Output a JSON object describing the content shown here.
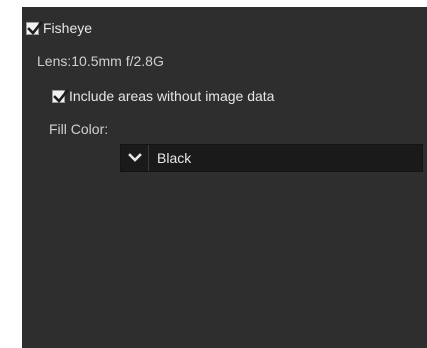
{
  "fisheye": {
    "label": "Fisheye",
    "checked": true
  },
  "lens": {
    "text": "Lens:10.5mm f/2.8G"
  },
  "include_areas": {
    "label": "Include areas without image data",
    "checked": true
  },
  "fill_color": {
    "label": "Fill Color:",
    "selected": "Black"
  },
  "icons": {
    "checkbox_check": "checkmark-icon",
    "dropdown_arrow": "chevron-down-icon"
  }
}
